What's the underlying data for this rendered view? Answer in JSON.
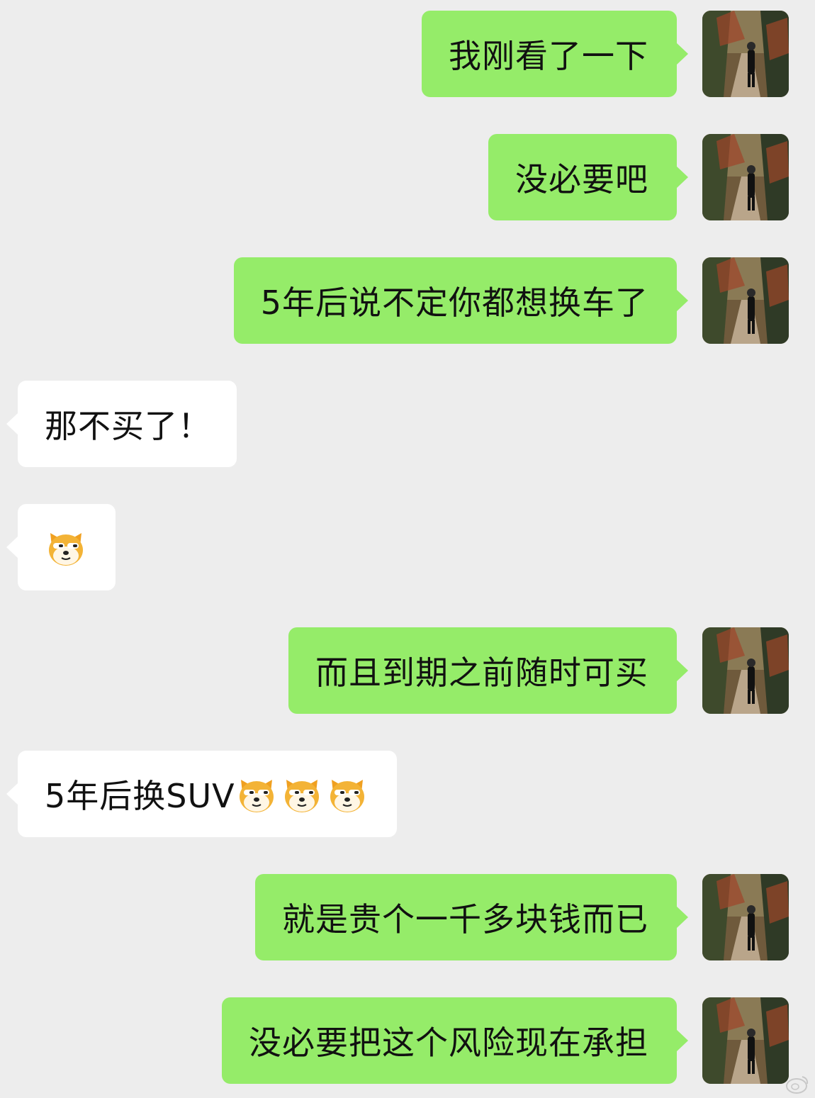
{
  "colors": {
    "background": "#ededed",
    "outgoing_bubble": "#95ec69",
    "incoming_bubble": "#ffffff",
    "text": "#111111"
  },
  "messages": [
    {
      "side": "out",
      "text": "我刚看了一下",
      "avatar": "user-photo-avatar"
    },
    {
      "side": "out",
      "text": "没必要吧",
      "avatar": "user-photo-avatar"
    },
    {
      "side": "out",
      "text": "5年后说不定你都想换车了",
      "avatar": "user-photo-avatar"
    },
    {
      "side": "in",
      "text": "那不买了！"
    },
    {
      "side": "in",
      "text": "",
      "emoji_count": 1,
      "emoji": "doge-emoji-icon"
    },
    {
      "side": "out",
      "text": "而且到期之前随时可买",
      "avatar": "user-photo-avatar"
    },
    {
      "side": "in",
      "text": "5年后换SUV",
      "emoji_count": 3,
      "emoji": "doge-emoji-icon"
    },
    {
      "side": "out",
      "text": "就是贵个一千多块钱而已",
      "avatar": "user-photo-avatar"
    },
    {
      "side": "out",
      "text": "没必要把这个风险现在承担",
      "avatar": "user-photo-avatar"
    }
  ]
}
